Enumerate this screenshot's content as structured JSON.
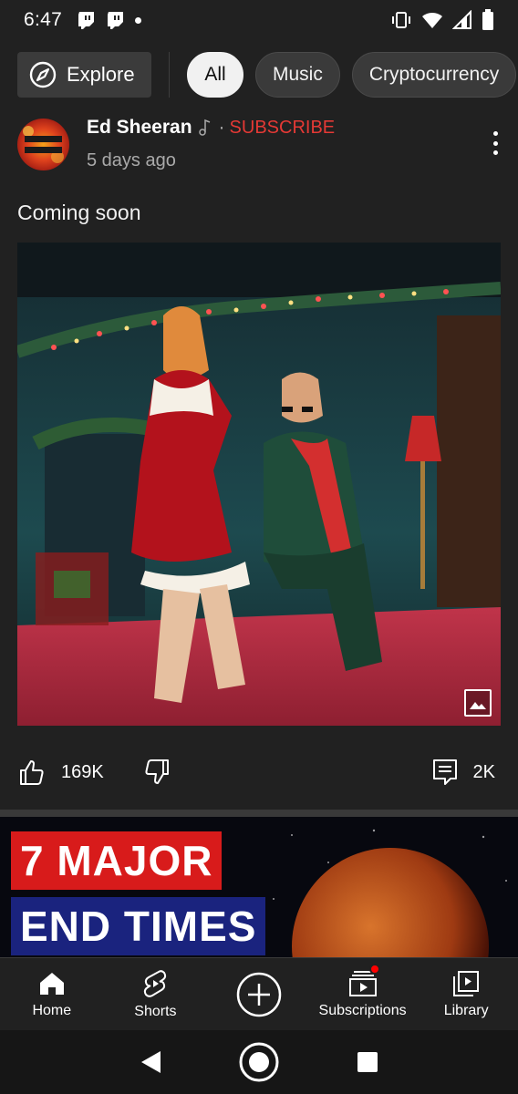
{
  "status_bar": {
    "time": "6:47"
  },
  "chips": {
    "explore_label": "Explore",
    "items": [
      {
        "label": "All",
        "active": true
      },
      {
        "label": "Music",
        "active": false
      },
      {
        "label": "Cryptocurrency",
        "active": false
      }
    ]
  },
  "post": {
    "channel": "Ed Sheeran",
    "separator": "·",
    "subscribe_label": "SUBSCRIBE",
    "time": "5 days ago",
    "text": "Coming soon",
    "likes": "169K",
    "comments": "2K"
  },
  "next_video": {
    "thumb_line1": "7 MAJOR",
    "thumb_line2": "END TIMES"
  },
  "bottom_nav": {
    "home": "Home",
    "shorts": "Shorts",
    "subscriptions": "Subscriptions",
    "library": "Library"
  },
  "colors": {
    "background": "#212121",
    "accent_red": "#e53935",
    "muted_text": "#aaaaaa"
  }
}
